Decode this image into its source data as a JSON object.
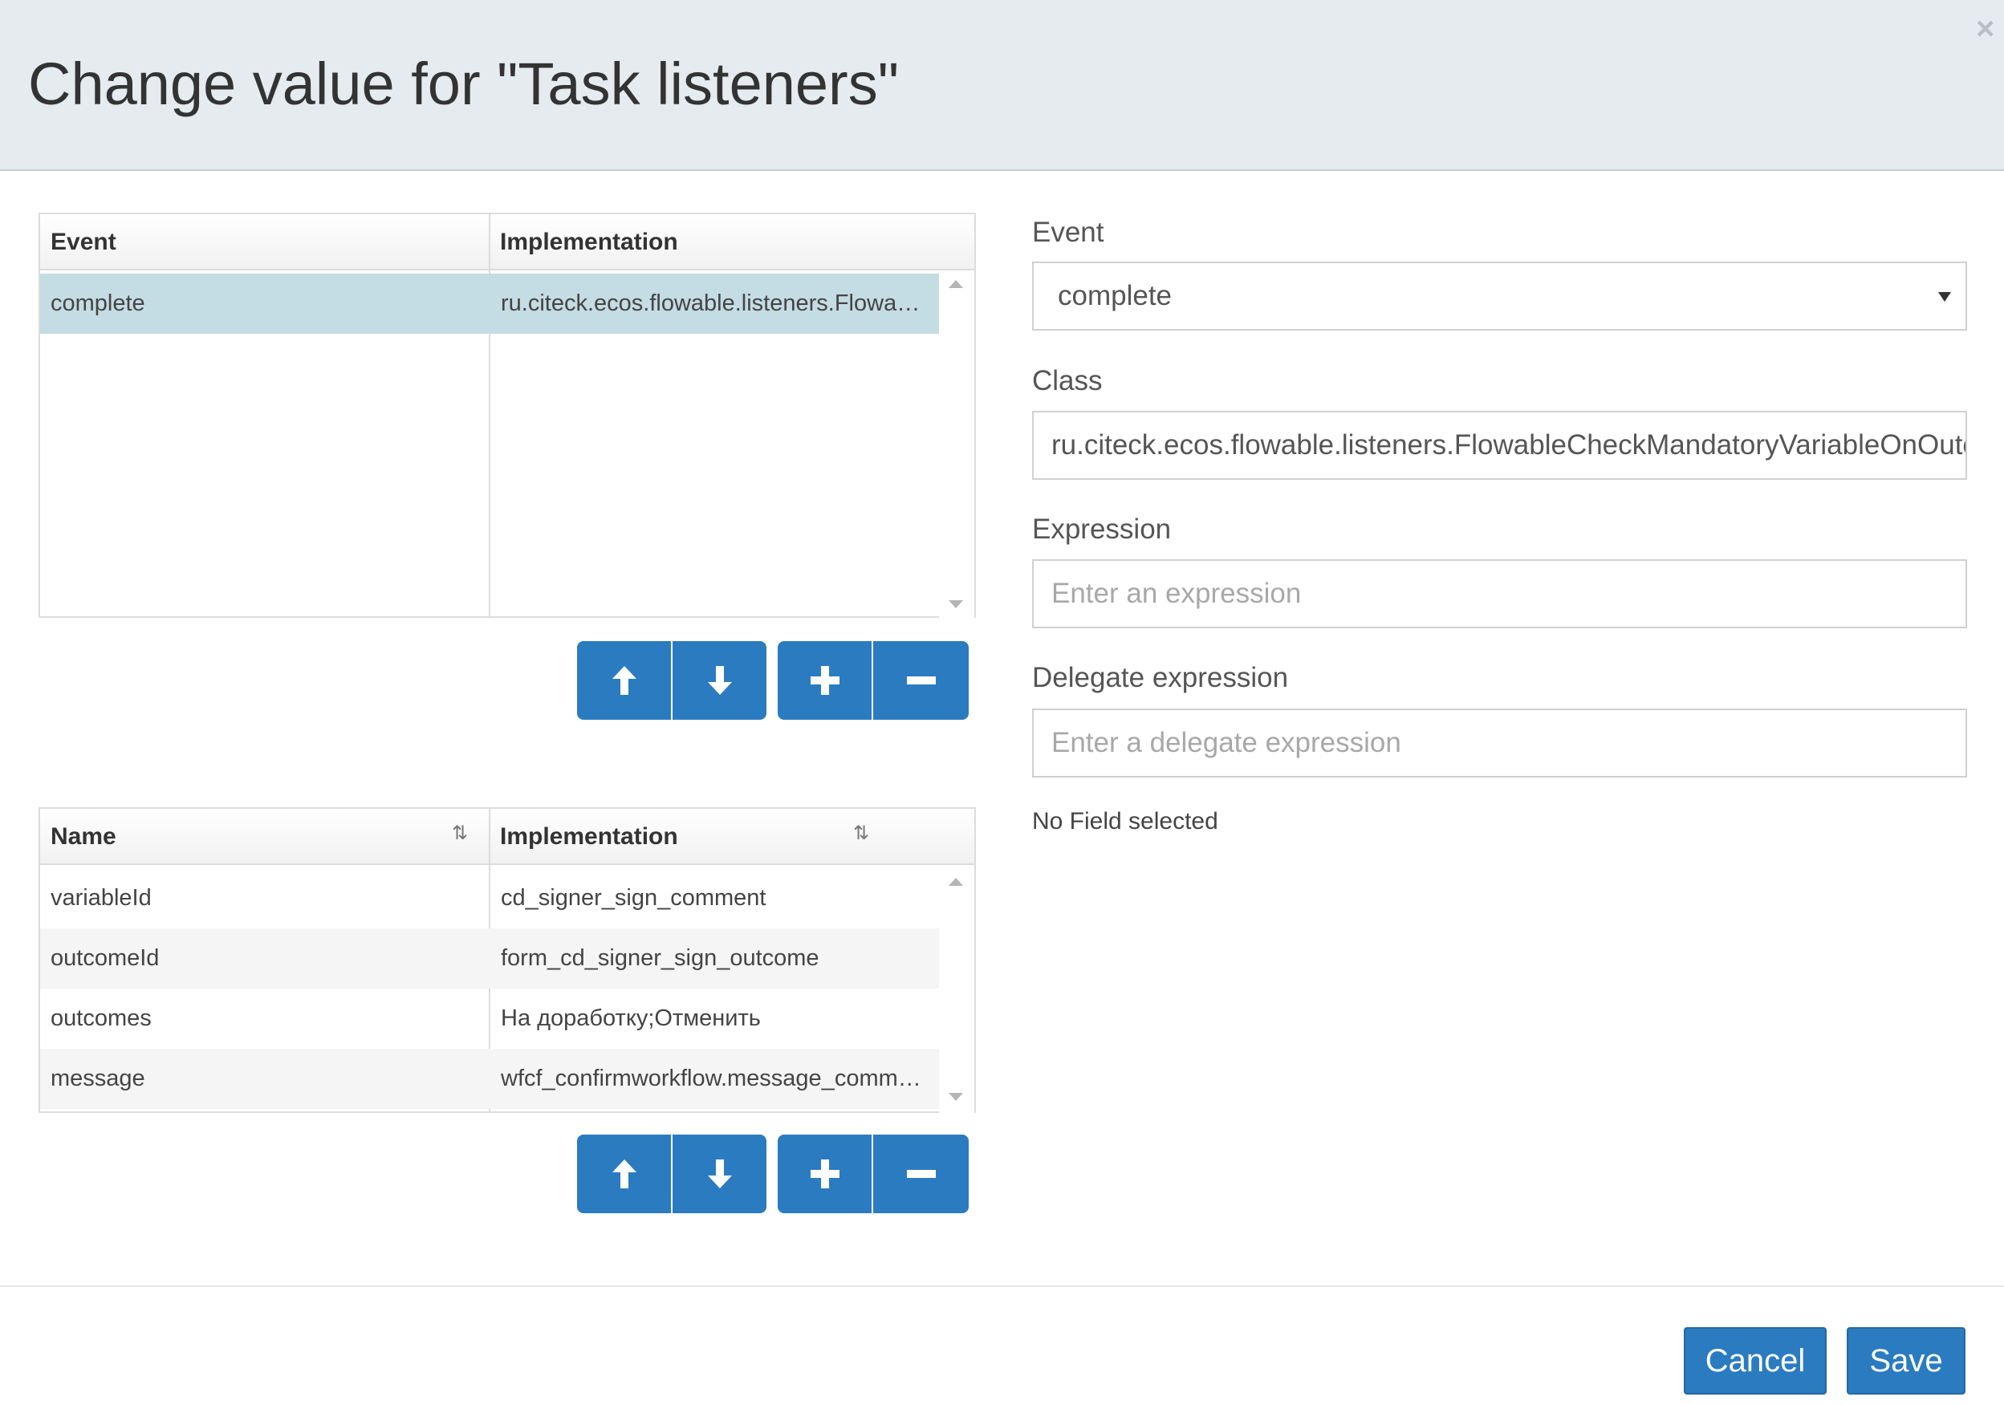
{
  "dialog": {
    "title": "Change value for \"Task listeners\"",
    "close_glyph": "×"
  },
  "listeners_grid": {
    "columns": [
      "Event",
      "Implementation"
    ],
    "rows": [
      {
        "event": "complete",
        "implementation": "ru.citeck.ecos.flowable.listeners.FlowableCheckMandatoryVariableOnOutcome"
      }
    ],
    "selected_row": 0
  },
  "fields_grid": {
    "columns": [
      "Name",
      "Implementation"
    ],
    "rows": [
      {
        "name": "variableId",
        "implementation": "cd_signer_sign_comment"
      },
      {
        "name": "outcomeId",
        "implementation": "form_cd_signer_sign_outcome"
      },
      {
        "name": "outcomes",
        "implementation": "На доработку;Отменить"
      },
      {
        "name": "message",
        "implementation": "wfcf_confirmworkflow.message_comment"
      }
    ]
  },
  "form": {
    "event_label": "Event",
    "event_value": "complete",
    "class_label": "Class",
    "class_value": "ru.citeck.ecos.flowable.listeners.FlowableCheckMandatoryVariableOnOutcome",
    "expression_label": "Expression",
    "expression_placeholder": "Enter an expression",
    "delegate_label": "Delegate expression",
    "delegate_placeholder": "Enter a delegate expression",
    "no_field_text": "No Field selected"
  },
  "footer": {
    "cancel_label": "Cancel",
    "save_label": "Save"
  },
  "icons": [
    "arrow-up-icon",
    "arrow-down-icon",
    "plus-icon",
    "minus-icon",
    "sort-icon",
    "close-icon",
    "dropdown-caret-icon"
  ],
  "colors": {
    "primary": "#2b7bc1",
    "header_bg": "#e5ebef",
    "selected_row": "#c4dce3"
  }
}
